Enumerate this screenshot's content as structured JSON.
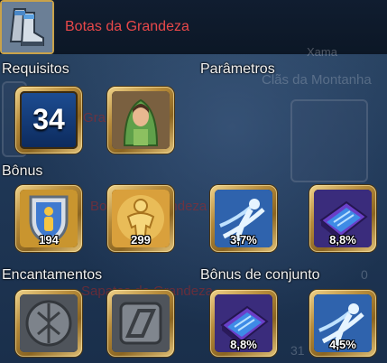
{
  "item": {
    "name": "Botas da Grandeza",
    "icon": "boots-icon"
  },
  "background_text": {
    "xama": "Xama",
    "clan": "Clãs da Montanha",
    "ghost_title_1": "Grandeza",
    "ghost_title_2": "Botas da Grandeza",
    "ghost_title_3": "Sapatos da Grandeza",
    "ghost_num": "31",
    "ghost_zero": "0"
  },
  "sections": {
    "requirements": "Requisitos",
    "parameters": "Parâmetros",
    "bonus": "Bônus",
    "enchantments": "Encantamentos",
    "set_bonus": "Bônus de conjunto"
  },
  "requirements": {
    "level": "34",
    "class_icon": "hooded-character-icon"
  },
  "bonus": [
    {
      "icon": "shield-person-icon",
      "value": "194"
    },
    {
      "icon": "golden-person-icon",
      "value": "299"
    },
    {
      "icon": "wind-dash-icon",
      "value": "3,7%"
    },
    {
      "icon": "spellbook-icon",
      "value": "8,8%"
    }
  ],
  "enchantments": [
    {
      "icon": "stone-rune-circle-icon"
    },
    {
      "icon": "stone-rune-square-icon"
    }
  ],
  "set_bonus": [
    {
      "icon": "spellbook-icon",
      "value": "8,8%"
    },
    {
      "icon": "wind-dash-icon",
      "value": "4,5%"
    }
  ]
}
